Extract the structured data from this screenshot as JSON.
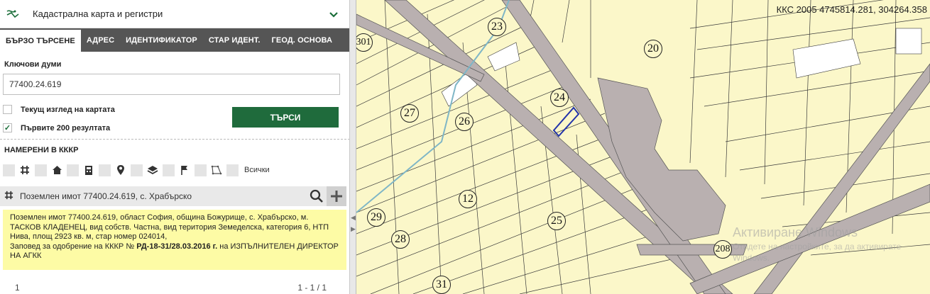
{
  "header": {
    "title": "Кадастрална карта и регистри"
  },
  "tabs": [
    {
      "label": "БЪРЗО ТЪРСЕНЕ",
      "active": true
    },
    {
      "label": "АДРЕС"
    },
    {
      "label": "ИДЕНТИФИКАТОР"
    },
    {
      "label": "СТАР ИДЕНТ."
    },
    {
      "label": "ГЕОД. ОСНОВА"
    }
  ],
  "search": {
    "keywords_label": "Ключови думи",
    "value": "77400.24.619",
    "current_view_label": "Текущ изглед на картата",
    "current_view_checked": false,
    "first200_label": "Първите 200 резултата",
    "first200_checked": true,
    "button": "ТЪРСИ"
  },
  "found": {
    "title": "НАМЕРЕНИ В КККР",
    "filter_all": "Всички",
    "filter_icons": [
      "grid-icon",
      "house-icon",
      "device-icon",
      "pin-icon",
      "layers-icon",
      "flag-icon",
      "polygon-icon"
    ]
  },
  "result": {
    "label": "Поземлен имот 77400.24.619, с. Храбърско",
    "detail_part1": "Поземлен имот 77400.24.619, област София, община Божурище, с. Храбърско, м. ТАСКОВ КЛАДЕНЕЦ, вид собств. Частна, вид територия Земеделска, категория 6, НТП Нива, площ 2923 кв. м, стар номер 024014,",
    "detail_part2": "Заповед за одобрение на КККР №",
    "detail_bold": "РД-18-31/28.03.2016 г.",
    "detail_part3": "на ИЗПЪЛНИТЕЛЕН ДИРЕКТОР НА АГКК"
  },
  "pagination": {
    "page": "1",
    "count": "1 - 1 / 1"
  },
  "map": {
    "coords": "ККС 2005 4745814.281, 304264.358",
    "parcel_labels": [
      "23",
      "20",
      "24",
      "27",
      "26",
      "12",
      "25",
      "29",
      "28",
      "208",
      "31",
      "301"
    ],
    "watermark_title": "Активиране Windows",
    "watermark_text_1": "Отидете на настройките, за да активирате",
    "watermark_text_2": "Windows.",
    "colors": {
      "land": "#fbf7c9",
      "road": "#b9b0b0",
      "selected": "#2233aa"
    }
  }
}
